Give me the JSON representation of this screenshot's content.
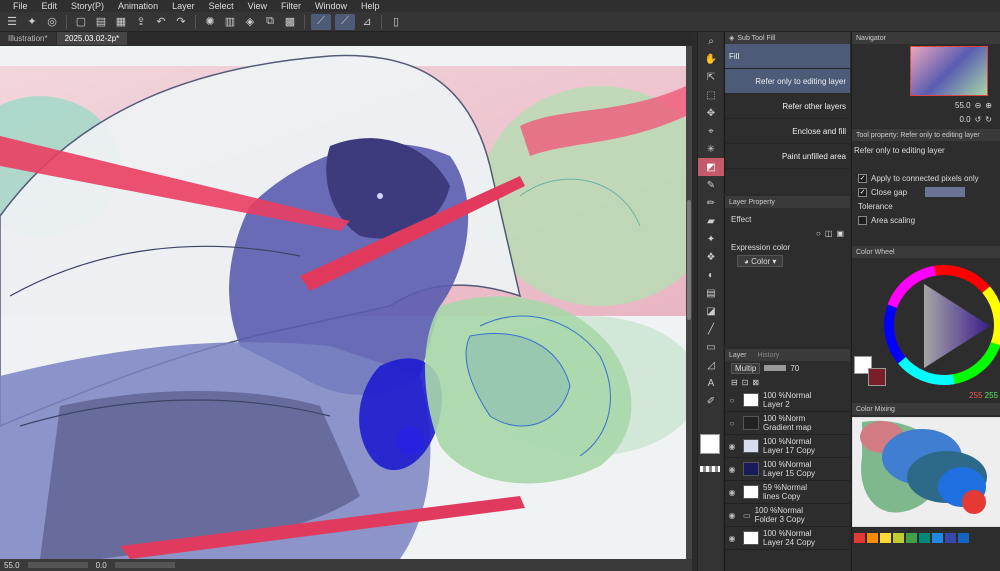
{
  "menu": [
    "File",
    "Edit",
    "Story(P)",
    "Animation",
    "Layer",
    "Select",
    "View",
    "Filter",
    "Window",
    "Help"
  ],
  "tabs": [
    "Illustration*",
    "2025.03.02-2p*"
  ],
  "status": {
    "zoom": "55.0",
    "angle": "0.0"
  },
  "subtool": {
    "title": "Sub Tool Fill",
    "items": [
      "Fill",
      "Refer only to editing layer",
      "Refer other layers",
      "Enclose and fill",
      "Paint unfilled area"
    ]
  },
  "layer_property": {
    "title": "Layer Property",
    "effect_label": "Effect",
    "expression_label": "Expression color",
    "expression_value": "Color"
  },
  "layers_panel": {
    "tabs": [
      "Layer",
      "History"
    ],
    "blend": "Multip",
    "opacity": "70",
    "layers": [
      {
        "line1": "100 %Normal",
        "line2": "Layer 2"
      },
      {
        "line1": "100 %Norm",
        "line2": "Gradient map"
      },
      {
        "line1": "100 %Normal",
        "line2": "Layer 17 Copy"
      },
      {
        "line1": "100 %Normal",
        "line2": "Layer 15 Copy"
      },
      {
        "line1": "59 %Normal",
        "line2": "lines Copy"
      },
      {
        "line1": "100 %Normal",
        "line2": "Folder 3 Copy"
      },
      {
        "line1": "100 %Normal",
        "line2": "Layer 24 Copy"
      }
    ]
  },
  "navigator": {
    "title": "Navigator",
    "zoom": "55.0",
    "angle": "0.0"
  },
  "tool_property": {
    "title": "Tool property: Refer only to editing layer",
    "name": "Refer only to editing layer",
    "apply_label": "Apply to connected pixels only",
    "close_gap_label": "Close gap",
    "tolerance_label": "Tolerance",
    "area_label": "Area scaling"
  },
  "color_wheel": {
    "title": "Color Wheel",
    "r": "255",
    "g": "255"
  },
  "color_mixing": {
    "title": "Color Mixing"
  },
  "palette_colors": [
    "#e53935",
    "#fb8c00",
    "#fdd835",
    "#c0ca33",
    "#43a047",
    "#00897b",
    "#1e88e5",
    "#3949ab",
    "#1565c0"
  ]
}
